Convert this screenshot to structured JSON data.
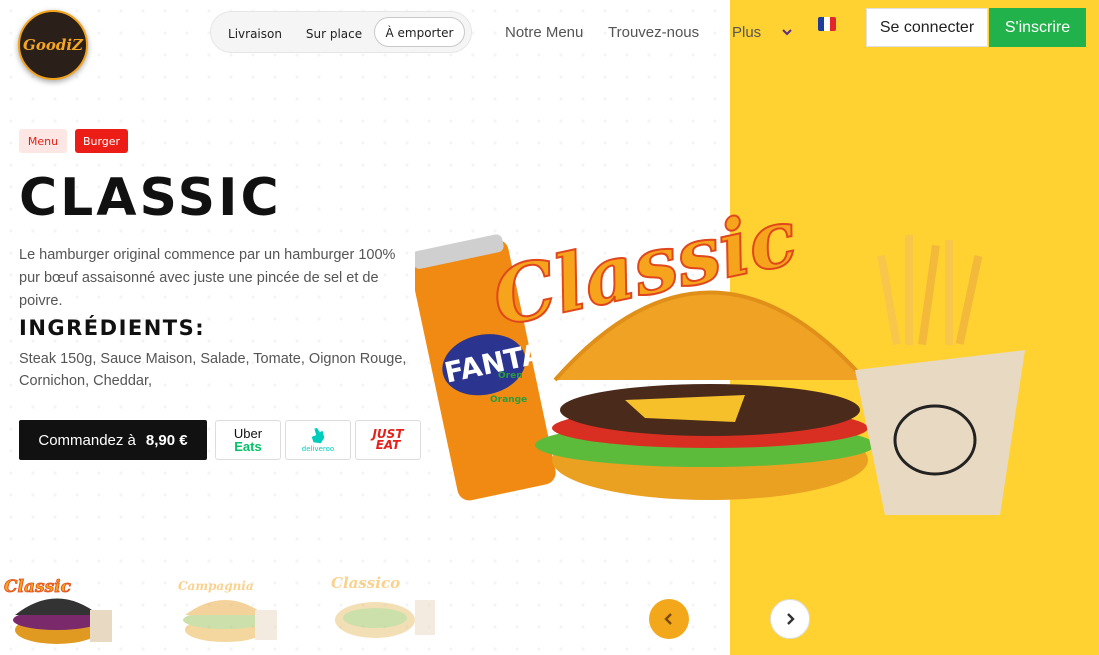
{
  "header": {
    "logo_text": "GoodiZ",
    "modes": [
      {
        "label": "Livraison"
      },
      {
        "label": "Sur place"
      },
      {
        "label": "À emporter",
        "active": true
      }
    ],
    "nav": [
      {
        "label": "Notre Menu"
      },
      {
        "label": "Trouvez-nous"
      },
      {
        "label": "Plus"
      }
    ],
    "language": "fr",
    "login_label": "Se connecter",
    "signup_label": "S'inscrire"
  },
  "breadcrumb": {
    "items": [
      "Menu",
      "Burger"
    ]
  },
  "product": {
    "name": "Classic",
    "description": "Le hamburger original commence par un hamburger 100% pur bœuf assaisonné avec juste une pincée de sel et de poivre.",
    "ingredients_title": "INGRÉDIENTS:",
    "ingredients": "Steak 150g, Sauce Maison, Salade, Tomate, Oignon Rouge, Cornichon, Cheddar,",
    "order_label": "Commandez à",
    "price": "8,90 €",
    "hero_title": "Classic",
    "can_label": "FANTA",
    "can_sub1": "Oren",
    "can_sub2": "Orange"
  },
  "partners": {
    "uber_line1": "Uber",
    "uber_line2": "Eats",
    "deliveroo": "deliveroo",
    "just_line1": "JUST",
    "just_line2": "EAT"
  },
  "carousel": {
    "thumbs": [
      {
        "label": "Classic"
      },
      {
        "label": "Campagnia"
      },
      {
        "label": "Classico"
      }
    ]
  },
  "colors": {
    "accent_red": "#ec1c16",
    "green": "#21b24b",
    "yellow": "#ffd232",
    "arrow_orange": "#f2a81a"
  }
}
